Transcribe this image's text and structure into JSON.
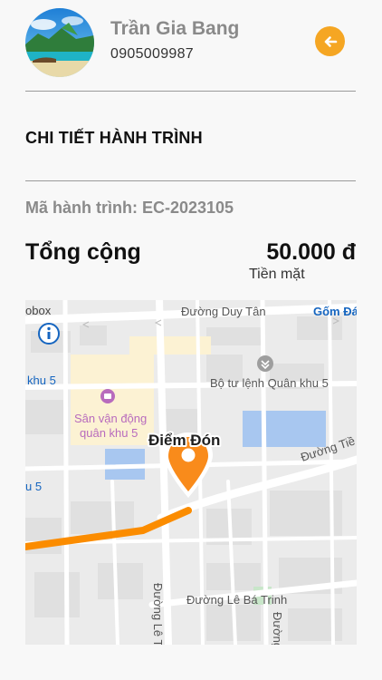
{
  "user": {
    "name": "Trần Gia Bang",
    "phone": "0905009987"
  },
  "back_icon": "arrow-left-icon",
  "section_title": "CHI TIẾT HÀNH TRÌNH",
  "trip": {
    "code_label": "Mã hành trình: EC-2023105"
  },
  "total": {
    "label": "Tổng cộng",
    "amount": "50.000 đ",
    "payment_method": "Tiền mặt"
  },
  "map": {
    "pickup_label": "Điểm Đón",
    "attribution": "obox",
    "streets": [
      "Đường Duy Tân",
      "Đường Tiề",
      "Đường Lê Bá Trinh",
      "Đường Lê T",
      "Đường"
    ],
    "places": [
      "Gốm Đá",
      "Bộ tư lệnh Quân khu 5",
      "khu 5",
      "Sân vận động",
      "quân khu 5",
      "u 5"
    ]
  },
  "colors": {
    "accent": "#f5a623",
    "route": "#fb8c00",
    "pin": "#f98b1b"
  }
}
